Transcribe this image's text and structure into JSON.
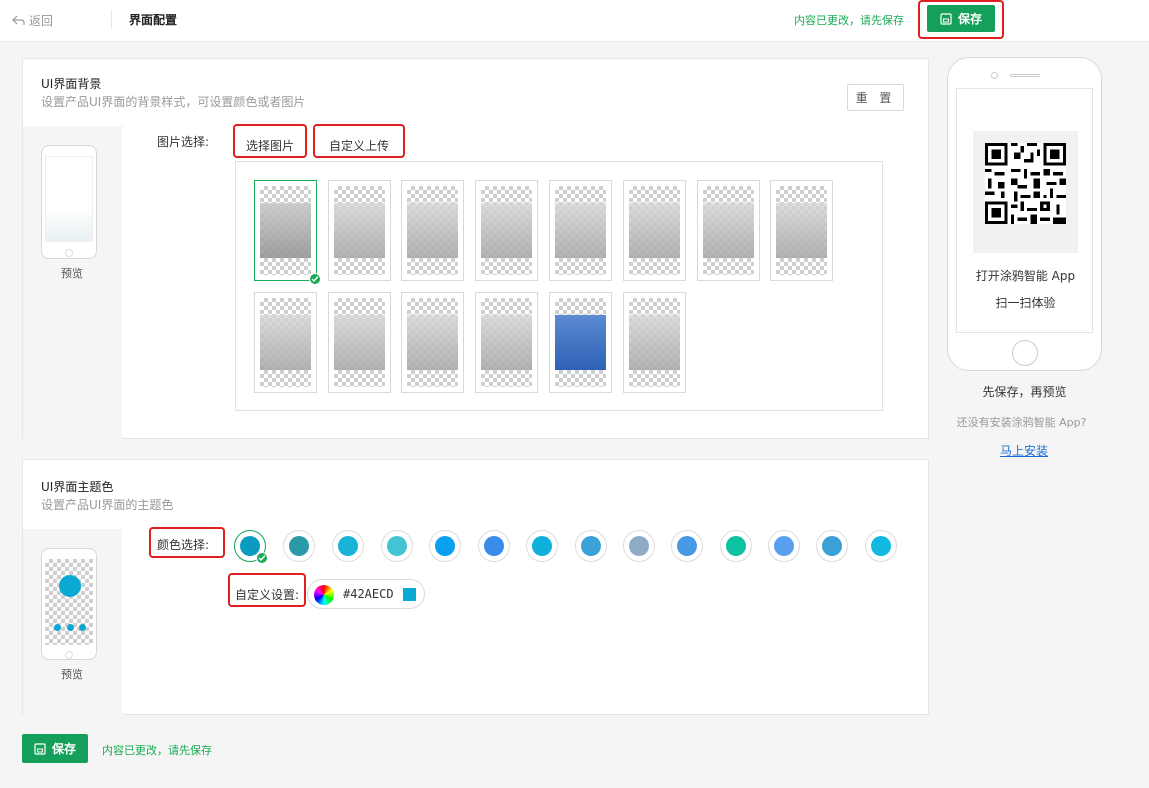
{
  "header": {
    "back_label": "返回",
    "title": "界面配置",
    "unsaved_notice": "内容已更改，请先保存",
    "save_label": "保存"
  },
  "background_section": {
    "title": "UI界面背景",
    "subtitle": "设置产品UI界面的背景样式，可设置颜色或者图片",
    "reset_label": "重 置",
    "preview_label": "预览",
    "image_select_label": "图片选择:",
    "tabs": [
      "选择图片",
      "自定义上传"
    ],
    "selected_thumbnail": 1,
    "thumbnail_count": 14
  },
  "theme_section": {
    "title": "UI界面主题色",
    "subtitle": "设置产品UI界面的主题色",
    "preview_label": "预览",
    "color_select_label": "颜色选择:",
    "custom_label": "自定义设置:",
    "custom_value": "#42AECD",
    "custom_color": "#0aa9d4",
    "preview_accent": "#0aa9d4",
    "selected_swatch": 1,
    "swatches": [
      "#0a9cc0",
      "#2a9aa8",
      "#1ab2d8",
      "#42c4d3",
      "#0aa0f0",
      "#3a8cec",
      "#10b0dc",
      "#3ba2d8",
      "#8eacc8",
      "#4899e4",
      "#0cc2a0",
      "#5aa0f0",
      "#3aa0d6",
      "#12b8e0"
    ]
  },
  "side_panel": {
    "qr_caption_line1": "打开涂鸦智能 App",
    "qr_caption_line2": "扫一扫体验",
    "save_first": "先保存，再预览",
    "not_installed": "还没有安装涂鸦智能 App?",
    "install_link": "马上安装"
  },
  "footer": {
    "save_label": "保存",
    "unsaved_notice": "内容已更改，请先保存"
  },
  "colors": {
    "primary": "#14a05a",
    "notice": "#1aaa55",
    "link": "#1a6fd6",
    "highlight": "#e02020"
  }
}
